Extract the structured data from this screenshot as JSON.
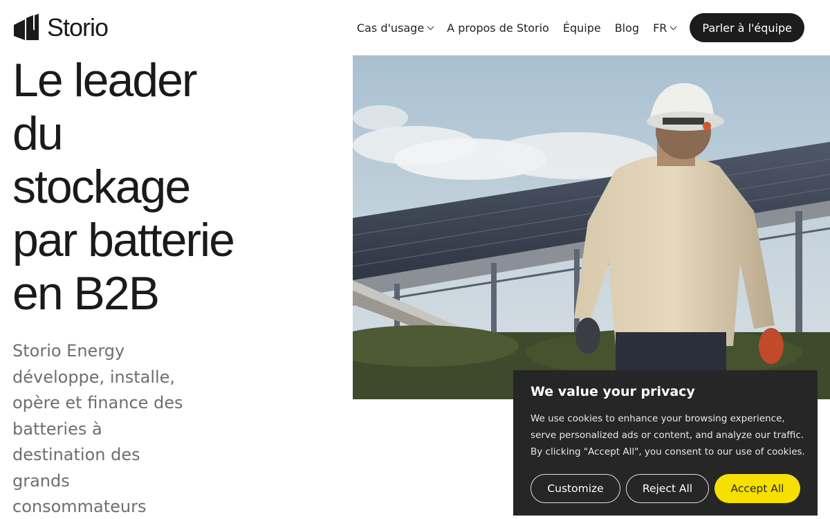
{
  "header": {
    "logo_text": "Storio",
    "nav": {
      "use_cases": "Cas d'usage",
      "about": "A propos de Storio",
      "team": "Équipe",
      "blog": "Blog",
      "language": "FR"
    },
    "cta_label": "Parler à l'équipe"
  },
  "hero": {
    "headline_lines": [
      "Le leader",
      "du",
      "stockage",
      "par batterie",
      "en B2B"
    ],
    "subtitle_lines": [
      "Storio Energy",
      "développe, installe,",
      "opère et finance des",
      "batteries à",
      "destination des",
      "grands",
      "consommateurs"
    ]
  },
  "cookie_banner": {
    "title": "We value your privacy",
    "text_lines": [
      "We use cookies to enhance your browsing experience,",
      "serve personalized ads or content, and analyze our traffic.",
      "By clicking \"Accept All\", you consent to our use of cookies."
    ],
    "customize_label": "Customize",
    "reject_label": "Reject All",
    "accept_label": "Accept All"
  },
  "colors": {
    "cta_background": "#1c1c1c",
    "cookie_background": "#262626",
    "accept_button": "#f5e000",
    "subtitle_text": "#6e6e6e"
  }
}
